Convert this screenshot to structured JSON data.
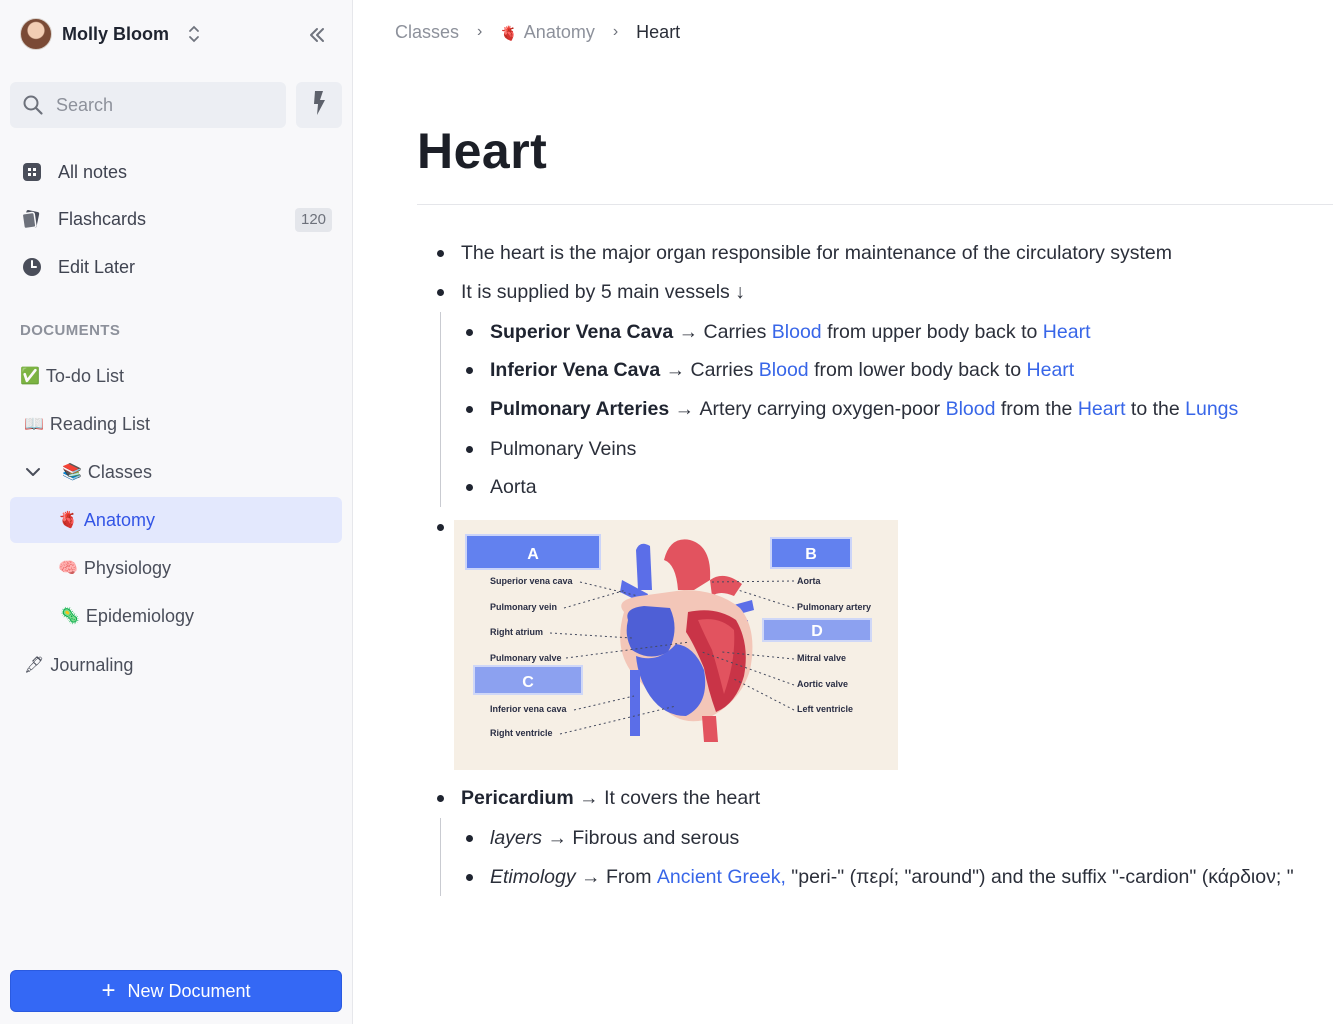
{
  "sidebar": {
    "user_name": "Molly Bloom",
    "search_placeholder": "Search",
    "nav": [
      {
        "label": "All notes",
        "icon": "grid-icon"
      },
      {
        "label": "Flashcards",
        "icon": "cards-icon",
        "count": "120"
      },
      {
        "label": "Edit Later",
        "icon": "clock-icon"
      }
    ],
    "documents_label": "DOCUMENTS",
    "documents": [
      {
        "emoji": "✅",
        "label": "To-do List"
      },
      {
        "emoji": "📖",
        "label": "Reading List"
      },
      {
        "emoji": "📚",
        "label": "Classes",
        "expanded": true
      },
      {
        "emoji": "🫀",
        "label": "Anatomy",
        "active": true
      },
      {
        "emoji": "🧠",
        "label": "Physiology"
      },
      {
        "emoji": "🦠",
        "label": "Epidemiology"
      },
      {
        "emoji": "🖋",
        "label": "Journaling"
      }
    ],
    "new_document_label": "New Document"
  },
  "breadcrumb": {
    "items": [
      "Classes",
      "Anatomy",
      "Heart"
    ],
    "anatomy_emoji": "🫀"
  },
  "page": {
    "title": "Heart",
    "b1": "The heart is the major organ responsible for maintenance of the circulatory system",
    "b2": "It is supplied by 5 main vessels ↓",
    "vessels": [
      {
        "name": "Superior Vena Cava",
        "t1": "Carries",
        "l1": "Blood",
        "t2": "from upper body back to",
        "l2": "Heart"
      },
      {
        "name": "Inferior Vena Cava",
        "t1": "Carries",
        "l1": "Blood",
        "t2": "from lower body back to",
        "l2": "Heart"
      },
      {
        "name": "Pulmonary Arteries",
        "t1": "Artery carrying oxygen-poor",
        "l1": "Blood",
        "t2": "from the",
        "l2": "Heart",
        "t3": "to the",
        "l3": "Lungs"
      },
      {
        "name": "Pulmonary Veins"
      },
      {
        "name": "Aorta"
      }
    ],
    "pericardium": {
      "name": "Pericardium",
      "text": "It covers the heart"
    },
    "layers": {
      "term": "layers",
      "text": "Fibrous and serous"
    },
    "etymology": {
      "term": "Etimology",
      "t1": "From",
      "link": "Ancient Greek,",
      "t2": "\"peri-\" (περί; \"around\") and the suffix \"-cardion\" (κάρδιον; \""
    },
    "arrow": "→"
  },
  "diagram": {
    "boxes": [
      "A",
      "B",
      "C",
      "D"
    ],
    "left_labels": [
      "Superior vena cava",
      "Pulmonary vein",
      "Right atrium",
      "Pulmonary valve",
      "Inferior vena cava",
      "Right ventricle"
    ],
    "right_labels": [
      "Aorta",
      "Pulmonary artery",
      "Mitral valve",
      "Aortic valve",
      "Left ventricle"
    ],
    "colors": {
      "blue": "#5b6ee8",
      "red": "#e2535f",
      "darkred": "#b8283a",
      "bg": "#f6efe5"
    }
  },
  "colors": {
    "accent": "#3468f5",
    "link": "#3866e8",
    "active_bg": "#e3e8fd"
  }
}
